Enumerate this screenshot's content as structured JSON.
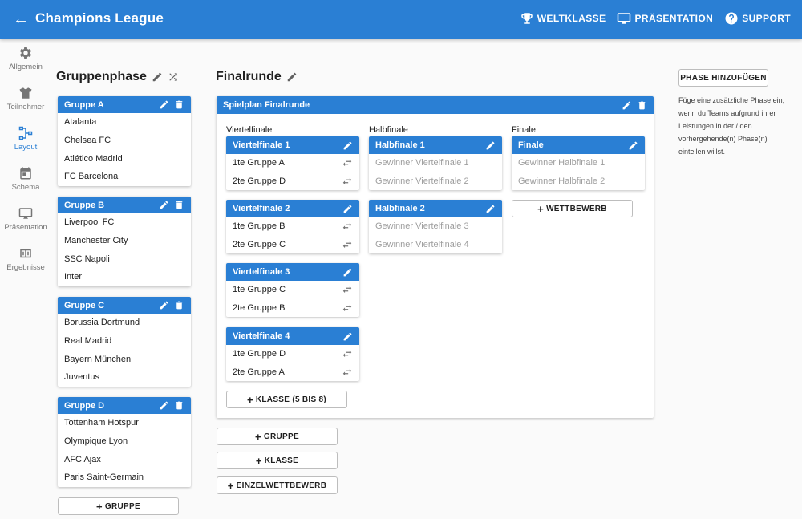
{
  "app": {
    "title": "Champions League"
  },
  "top_actions": [
    {
      "label": "WELTKLASSE",
      "icon": "trophy-icon"
    },
    {
      "label": "PRÄSENTATION",
      "icon": "presentation-icon"
    },
    {
      "label": "SUPPORT",
      "icon": "help-icon"
    }
  ],
  "nav": [
    {
      "label": "Allgemein",
      "icon": "gear-icon"
    },
    {
      "label": "Teilnehmer",
      "icon": "shirt-icon"
    },
    {
      "label": "Layout",
      "icon": "bracket-icon",
      "active": true
    },
    {
      "label": "Schema",
      "icon": "calendar-icon"
    },
    {
      "label": "Präsentation",
      "icon": "screen-icon"
    },
    {
      "label": "Ergebnisse",
      "icon": "scoreboard-icon"
    }
  ],
  "group_phase": {
    "title": "Gruppenphase",
    "groups": [
      {
        "name": "Gruppe A",
        "teams": [
          "Atalanta",
          "Chelsea FC",
          "Atlético Madrid",
          "FC Barcelona"
        ]
      },
      {
        "name": "Gruppe B",
        "teams": [
          "Liverpool FC",
          "Manchester City",
          "SSC Napoli",
          "Inter"
        ]
      },
      {
        "name": "Gruppe C",
        "teams": [
          "Borussia Dortmund",
          "Real Madrid",
          "Bayern München",
          "Juventus"
        ]
      },
      {
        "name": "Gruppe D",
        "teams": [
          "Tottenham Hotspur",
          "Olympique Lyon",
          "AFC Ajax",
          "Paris Saint-Germain"
        ]
      }
    ],
    "add_group_label": "GRUPPE"
  },
  "final_round": {
    "title": "Finalrunde",
    "panel_title": "Spielplan Finalrunde",
    "columns": {
      "quarter": "Viertelfinale",
      "semi": "Halbfinale",
      "final": "Finale"
    },
    "quarter_matches": [
      {
        "name": "Viertelfinale 1",
        "slots": [
          "1te Gruppe A",
          "2te Gruppe D"
        ]
      },
      {
        "name": "Viertelfinale 2",
        "slots": [
          "1te Gruppe B",
          "2te Gruppe C"
        ]
      },
      {
        "name": "Viertelfinale 3",
        "slots": [
          "1te Gruppe C",
          "2te Gruppe B"
        ]
      },
      {
        "name": "Viertelfinale 4",
        "slots": [
          "1te Gruppe D",
          "2te Gruppe A"
        ]
      }
    ],
    "semi_matches": [
      {
        "name": "Halbfinale 1",
        "slots": [
          "Gewinner Viertelfinale 1",
          "Gewinner Viertelfinale 2"
        ]
      },
      {
        "name": "Halbfinale 2",
        "slots": [
          "Gewinner Viertelfinale 3",
          "Gewinner Viertelfinale 4"
        ]
      }
    ],
    "final_match": {
      "name": "Finale",
      "slots": [
        "Gewinner Halbfinale 1",
        "Gewinner Halbfinale 2"
      ]
    },
    "add_class_label": "KLASSE (5 BIS 8)",
    "add_competition_label": "WETTBEWERB",
    "add_buttons": [
      "GRUPPE",
      "KLASSE",
      "EINZELWETTBEWERB"
    ]
  },
  "sidebar_right": {
    "add_phase_label": "PHASE HINZUFÜGEN",
    "hint": "Füge eine zusätzliche Phase ein, wenn du Teams aufgrund ihrer Leistungen in der / den vorhergehende(n) Phase(n) einteilen willst."
  },
  "colors": {
    "primary": "#2a7fd4",
    "muted_text": "#9e9e9e"
  }
}
